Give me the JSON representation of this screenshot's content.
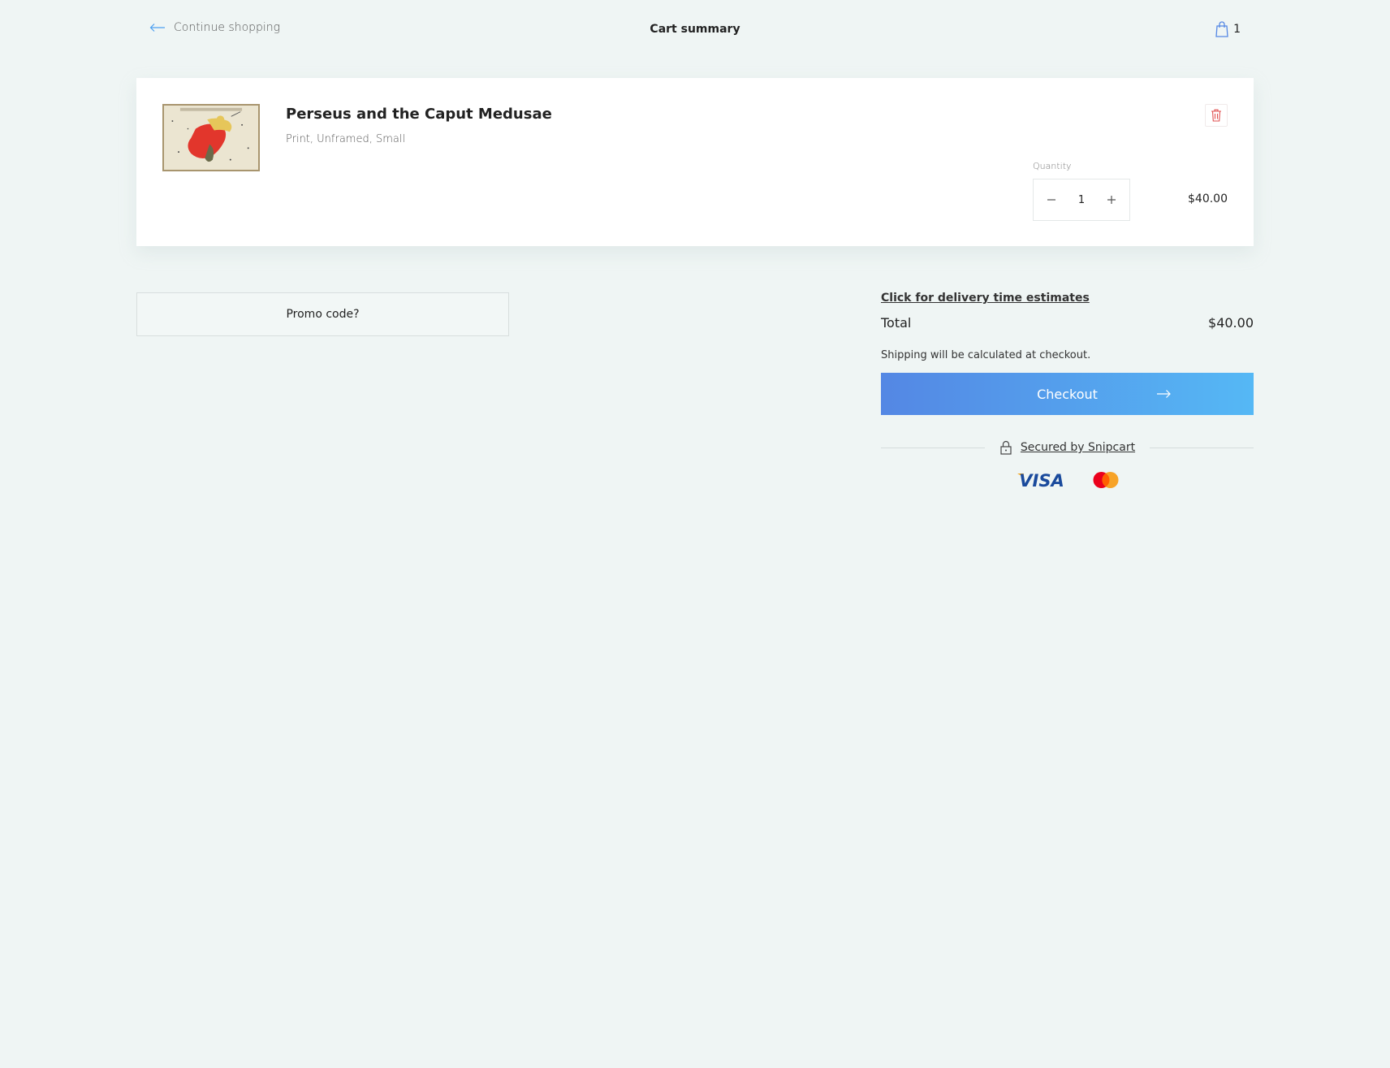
{
  "header": {
    "continue_label": "Continue shopping",
    "title": "Cart summary",
    "cart_count": "1"
  },
  "item": {
    "name": "Perseus and the Caput Medusae",
    "variant": "Print, Unframed, Small",
    "quantity_label": "Quantity",
    "quantity": "1",
    "price": "$40.00"
  },
  "promo": {
    "label": "Promo code?"
  },
  "summary": {
    "delivery_link": "Click for delivery time estimates",
    "total_label": "Total",
    "total_value": "$40.00",
    "shipping_note": "Shipping will be calculated at checkout.",
    "checkout_label": "Checkout",
    "secured_label": "Secured by Snipcart"
  },
  "icons": {
    "back": "arrow-left-icon",
    "cart": "shopping-bag-icon",
    "remove": "trash-icon",
    "decrease": "minus-icon",
    "increase": "plus-icon",
    "checkout": "arrow-right-icon",
    "secure": "lock-icon"
  },
  "colors": {
    "accent": "#4b9ff0",
    "remove": "#e05050",
    "checkout_start": "#5487e4",
    "checkout_end": "#55b8f5"
  }
}
